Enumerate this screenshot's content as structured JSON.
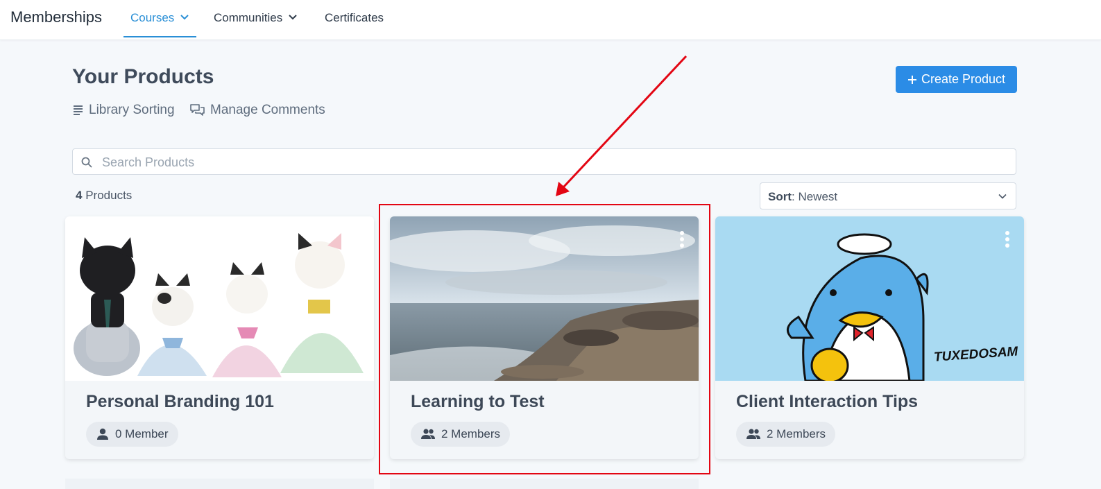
{
  "app": {
    "title": "Memberships"
  },
  "nav": {
    "tabs": [
      {
        "label": "Courses",
        "active": true,
        "has_dropdown": true
      },
      {
        "label": "Communities",
        "active": false,
        "has_dropdown": true
      },
      {
        "label": "Certificates",
        "active": false,
        "has_dropdown": false
      }
    ]
  },
  "header": {
    "title": "Your Products",
    "links": [
      {
        "label": "Library Sorting",
        "icon": "list-icon"
      },
      {
        "label": "Manage Comments",
        "icon": "comments-icon"
      }
    ],
    "create_button": {
      "label": "Create Product",
      "icon": "plus-icon"
    }
  },
  "search": {
    "placeholder": "Search Products",
    "value": ""
  },
  "summary": {
    "count": "4",
    "count_label": "Products"
  },
  "sort": {
    "label": "Sort",
    "value": "Newest"
  },
  "products": [
    {
      "title": "Personal Branding 101",
      "members": "0 Member",
      "image": "toy-cat-family"
    },
    {
      "title": "Learning to Test",
      "members": "2 Members",
      "image": "rocky-seashore"
    },
    {
      "title": "Client Interaction Tips",
      "members": "2 Members",
      "image": "tuxedosam-penguin"
    }
  ],
  "illustration_text": {
    "tuxedosam_logo": "TUXEDOSAM"
  },
  "colors": {
    "accent": "#2a8fd6",
    "primary_button": "#2b8ce6",
    "annotation": "#e30613",
    "page_bg": "#f5f8fb"
  },
  "annotation": {
    "type": "arrow-and-box",
    "target": "Learning to Test"
  }
}
